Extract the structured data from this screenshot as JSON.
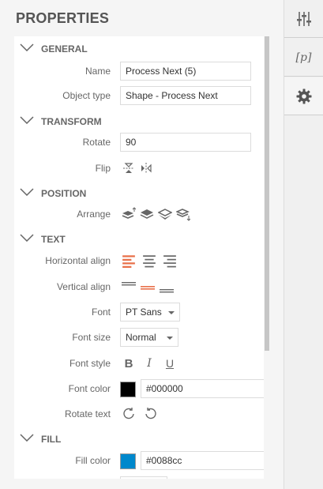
{
  "panel": {
    "title": "PROPERTIES"
  },
  "sections": {
    "general": "GENERAL",
    "transform": "TRANSFORM",
    "position": "POSITION",
    "text": "TEXT",
    "fill": "FILL"
  },
  "general": {
    "name_label": "Name",
    "name_value": "Process Next (5)",
    "type_label": "Object type",
    "type_value": "Shape - Process Next"
  },
  "transform": {
    "rotate_label": "Rotate",
    "rotate_value": "90",
    "flip_label": "Flip"
  },
  "position": {
    "arrange_label": "Arrange"
  },
  "text": {
    "halign_label": "Horizontal align",
    "valign_label": "Vertical align",
    "font_label": "Font",
    "font_value": "PT Sans",
    "fontsize_label": "Font size",
    "fontsize_value": "Normal",
    "fontstyle_label": "Font style",
    "bold": "B",
    "italic": "I",
    "underline": "U",
    "fontcolor_label": "Font color",
    "fontcolor_value": "#000000",
    "rotatetext_label": "Rotate text"
  },
  "fill": {
    "fillcolor_label": "Fill color",
    "fillcolor_value": "#0088cc"
  },
  "tabs": {
    "params_label": "[p]"
  },
  "colors": {
    "accent": "#e8704a",
    "font_color": "#000000",
    "fill_color": "#0088cc",
    "icon": "#666666"
  }
}
